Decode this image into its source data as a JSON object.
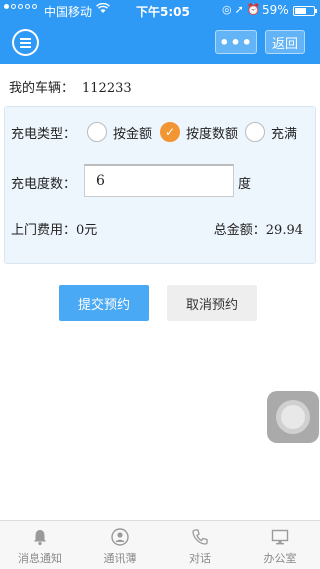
{
  "status_bar": {
    "carrier": "中国移动",
    "time": "下午5:05",
    "battery_percent": "59%",
    "battery_level": 0.59
  },
  "header": {
    "more_label": "•••",
    "back_label": "返回"
  },
  "vehicle": {
    "label": "我的车辆：",
    "value": "112233"
  },
  "charge_type": {
    "label": "充电类型：",
    "options": [
      {
        "label": "按金额",
        "selected": false
      },
      {
        "label": "按度数额",
        "selected": true
      },
      {
        "label": "充满",
        "selected": false
      }
    ]
  },
  "degrees": {
    "label": "充电度数：",
    "value": "6",
    "unit": "度"
  },
  "fee": {
    "label": "上门费用：",
    "value": "0元"
  },
  "total": {
    "label": "总金额：",
    "value": "29.94"
  },
  "actions": {
    "submit_label": "提交预约",
    "cancel_label": "取消预约"
  },
  "tabbar": {
    "items": [
      {
        "label": "消息通知",
        "icon": "bell-icon"
      },
      {
        "label": "通讯薄",
        "icon": "contact-icon"
      },
      {
        "label": "对话",
        "icon": "phone-icon"
      },
      {
        "label": "办公室",
        "icon": "monitor-icon"
      }
    ]
  },
  "colors": {
    "primary": "#2f9af5",
    "accent_check": "#f29533",
    "submit": "#4aa9f5"
  }
}
